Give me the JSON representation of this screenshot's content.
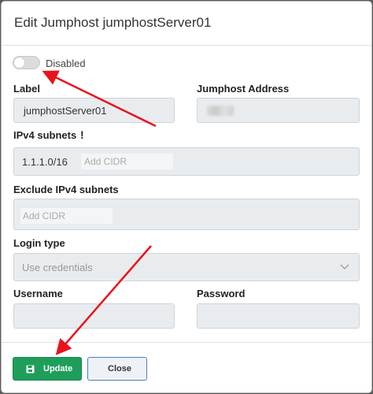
{
  "dialog": {
    "title": "Edit Jumphost jumphostServer01"
  },
  "status_toggle": {
    "label": "Disabled",
    "enabled": false
  },
  "label_field": {
    "label": "Label",
    "value": "jumphostServer01"
  },
  "address_field": {
    "label": "Jumphost Address"
  },
  "ipv4": {
    "label": "IPv4 subnets",
    "warning": "!",
    "chips": [
      "1.1.1.0/16"
    ],
    "placeholder": "Add CIDR"
  },
  "exclude_ipv4": {
    "label": "Exclude IPv4 subnets",
    "placeholder": "Add CIDR"
  },
  "login_type": {
    "label": "Login type",
    "selected": "Use credentials"
  },
  "username": {
    "label": "Username",
    "value": ""
  },
  "password": {
    "label": "Password",
    "value": ""
  },
  "buttons": {
    "update": "Update",
    "close": "Close"
  },
  "colors": {
    "primary": "#1e9e5a",
    "annotation_arrow": "#e8141b",
    "close_border": "#4a7fc0"
  }
}
